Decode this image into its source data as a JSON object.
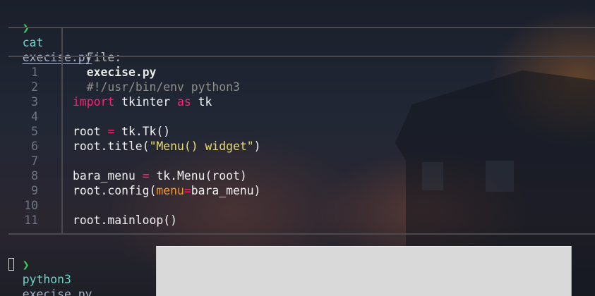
{
  "terminal": {
    "prompt_symbol": "❯",
    "first_command": {
      "cmd": "cat",
      "arg": "execise.py"
    },
    "second_command": {
      "cmd": "python3",
      "arg": "execise.py"
    }
  },
  "file_viewer": {
    "header_label": "File:",
    "file_name": "execise.py",
    "line_numbers": [
      "1",
      "2",
      "3",
      "4",
      "5",
      "6",
      "7",
      "8",
      "9",
      "10",
      "11"
    ],
    "code": {
      "l1": "#!/usr/bin/env python3",
      "l3_import": "import",
      "l3_mod": " tkinter ",
      "l3_as": "as",
      "l3_alias": " tk",
      "l5_a": "root ",
      "l5_eq": "=",
      "l5_b": " tk.Tk()",
      "l6_a": "root.title(",
      "l6_str": "\"Menu() widget\"",
      "l6_b": ")",
      "l8_a": "bara_menu ",
      "l8_eq": "=",
      "l8_b": " tk.Menu(root)",
      "l9_a": "root.config(",
      "l9_param": "menu",
      "l9_eq": "=",
      "l9_b": "bara_menu)",
      "l11": "root.mainloop()"
    }
  },
  "colors": {
    "prompt_green": "#3ec95a",
    "command_cyan": "#6ad7c5",
    "keyword_pink": "#f92672",
    "string_yellow": "#e6db74",
    "param_orange": "#fd971f",
    "tk_window_gray": "#d9d9d9"
  }
}
